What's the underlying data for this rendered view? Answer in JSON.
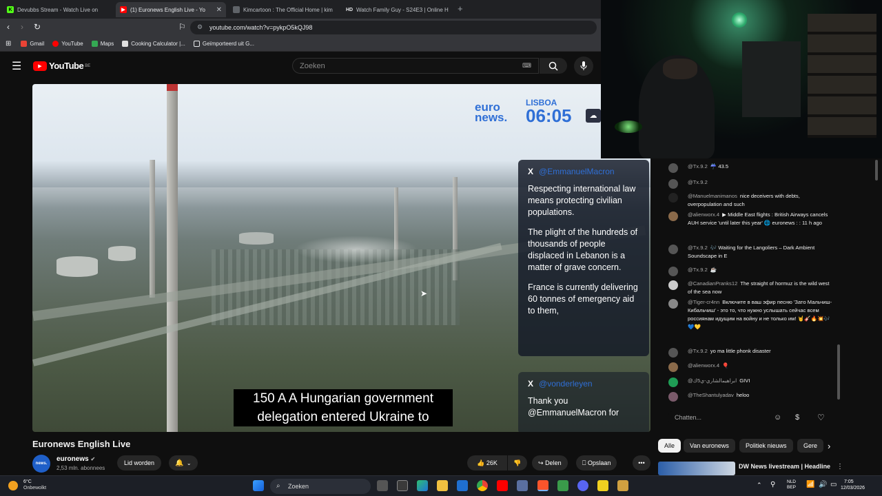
{
  "browser": {
    "tabs": [
      {
        "label": "Devubbs Stream - Watch Live on",
        "icon": "kick-icon",
        "color": "#53fc18"
      },
      {
        "label": "(1) Euronews English Live - Yo",
        "icon": "youtube-icon",
        "color": "#ff0000"
      },
      {
        "label": "Kimcartoon : The Official Home | kim",
        "icon": "globe-icon",
        "color": "#5f6368"
      },
      {
        "label": "Watch Family Guy - S24E3 | Online H",
        "icon": "hd-icon",
        "color": "#e8eaed"
      }
    ],
    "url": "youtube.com/watch?v=pykpO5kQJ98",
    "bookmarks": [
      "Gmail",
      "YouTube",
      "Maps",
      "Cooking Calculator |...",
      "Geïmporteerd uit G..."
    ]
  },
  "youtube": {
    "logo": "YouTube",
    "region": "BE",
    "search_placeholder": "Zoeken"
  },
  "video": {
    "brand_line1": "euro",
    "brand_line2": "news.",
    "city": "LISBOA",
    "time": "06:05",
    "x_post1_handle": "@EmmanuelMacron",
    "x_post1_paras": [
      "Respecting international law means protecting civilian populations.",
      "The plight of the hundreds of thousands of people displaced in Lebanon is a matter of grave concern.",
      "France is currently delivering 60 tonnes of emergency aid to them,"
    ],
    "x_post2_handle": "@vonderleyen",
    "x_post2_text": "Thank you @EmmanuelMacron for",
    "subtitle": "150 A A Hungarian government delegation entered Ukraine to"
  },
  "below": {
    "title": "Euronews English Live",
    "channel": "euronews",
    "subscribers": "2,53 mln. abonnees",
    "join": "Lid worden",
    "likes": "26K",
    "share": "Delen",
    "save": "Opslaan"
  },
  "chat": {
    "messages": [
      {
        "author": "@Tx.9.2",
        "text": "☔ 43.5"
      },
      {
        "author": "@Tx.9.2",
        "text": ""
      },
      {
        "author": "@Manuelmanimanos",
        "text": "nice deceivers with debts, overpopulation and such"
      },
      {
        "author": "@alienworx.4",
        "text": "▶ Middle East flights : British Airways cancels AUH service 'until later this year' 🌐 euronews : : 11 h ago"
      },
      {
        "author": "@Tx.9.2",
        "text": "🎶 Waiting for the Langoliers – Dark Ambient Soundscape in E"
      },
      {
        "author": "@Tx.9.2",
        "text": "☕"
      },
      {
        "author": "@CanadianPranks12",
        "text": "The straight of hormuz is the wild west of the sea now"
      },
      {
        "author": "@Tiger-cr4nn",
        "text": "Включите в ваш эфир песню 'Зато Мальчиш-Кибальчиш' - это то, что нужно услышать сейчас всем россиянам идущим на войну и не только им! 🤘🎸🔥💥🎶 💙💛"
      },
      {
        "author": "@Tx.9.2",
        "text": "yo ma little phonk disaster"
      },
      {
        "author": "@alienworx.4",
        "text": "🎈"
      },
      {
        "author": "@ابراهيمالشاري-ي5ك",
        "text": "GIVI"
      },
      {
        "author": "@TheShantulyadav",
        "text": "heloo"
      }
    ],
    "input_placeholder": "Chatten...",
    "chips": [
      "Alle",
      "Van euronews",
      "Politiek nieuws",
      "Gere"
    ],
    "rec_title": "DW News livestream | Headline"
  },
  "taskbar": {
    "weather_temp": "6°C",
    "weather_desc": "Onbewolkt",
    "search": "Zoeken",
    "lang1": "NLD",
    "lang2": "BEP",
    "time": "7:05",
    "date": "12/03/2026"
  }
}
